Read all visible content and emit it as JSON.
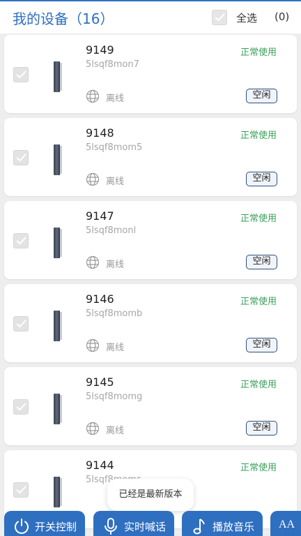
{
  "header": {
    "title": "我的设备（16）",
    "select_all_label": "全选",
    "selected_count": "(0)"
  },
  "devices": [
    {
      "name": "9149",
      "code": "5lsqf8mon7",
      "status": "正常使用",
      "network": "离线",
      "state": "空闲"
    },
    {
      "name": "9148",
      "code": "5lsqf8mom5",
      "status": "正常使用",
      "network": "离线",
      "state": "空闲"
    },
    {
      "name": "9147",
      "code": "5lsqf8monl",
      "status": "正常使用",
      "network": "离线",
      "state": "空闲"
    },
    {
      "name": "9146",
      "code": "5lsqf8momb",
      "status": "正常使用",
      "network": "离线",
      "state": "空闲"
    },
    {
      "name": "9145",
      "code": "5lsqf8momg",
      "status": "正常使用",
      "network": "离线",
      "state": "空闲"
    },
    {
      "name": "9144",
      "code": "5lsqf8moms",
      "status": "正常使用",
      "network": "",
      "state": ""
    }
  ],
  "toast": "已经是最新版本",
  "actions": {
    "power_label": "开关控制",
    "talk_label": "实时喊话",
    "music_label": "播放音乐",
    "font_label": "AA"
  },
  "icons": {
    "checkbox": "check-icon",
    "network": "globe-icon",
    "power": "power-icon",
    "talk": "microphone-icon",
    "music": "music-note-icon",
    "font": "font-size-icon"
  },
  "colors": {
    "accent": "#2f6fc0",
    "status_ok": "#3aa05a",
    "background": "#eeeeee"
  }
}
